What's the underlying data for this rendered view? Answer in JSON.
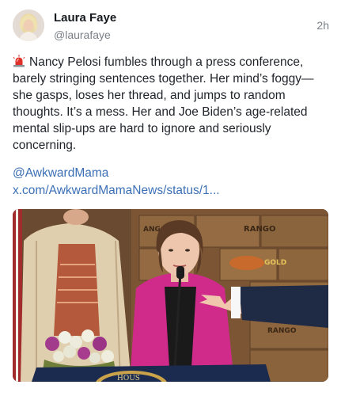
{
  "post": {
    "author": {
      "display_name": "Laura Faye",
      "handle": "@laurafaye"
    },
    "timestamp": "2h",
    "text": "Nancy Pelosi fumbles through a press conference, barely stringing sentences together. Her mind’s foggy—she gasps, loses her thread, and jumps to random thoughts. It’s a mess. Her and Joe Biden’s age-related mental slip-ups are hard to ignore and seriously concerning.",
    "mention": "@AwkwardMama",
    "link": "x.com/AwkwardMamaNews/status/1...",
    "media": {
      "box_labels": [
        "RANGO",
        "GOLD",
        "RANGO",
        "ANGO"
      ],
      "podium_label": "HOUS"
    }
  },
  "icons": {
    "siren": "police-light-icon",
    "avatar": "user-avatar"
  },
  "colors": {
    "link": "#3b6fb6",
    "handle": "#7b8088",
    "text": "#1f2329"
  }
}
